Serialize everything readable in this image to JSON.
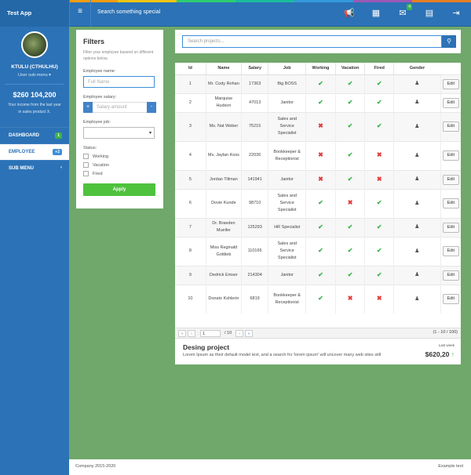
{
  "colors": {
    "primary": "#2c72b6",
    "success": "#3bb34a",
    "danger": "#e33d3d",
    "background": "#6fa86a",
    "stripe": [
      "#e74c3c",
      "#f39c12",
      "#f1c40f",
      "#2ecc71",
      "#1abc9c",
      "#3498db",
      "#9b59b6",
      "#e67e22"
    ]
  },
  "topbar": {
    "app_title": "Test App",
    "menu_icon": "≡",
    "search_placeholder": "Search something special",
    "icons": [
      {
        "name": "megaphone-icon",
        "glyph": "📢",
        "badge": ""
      },
      {
        "name": "grid-icon",
        "glyph": "▦",
        "badge": ""
      },
      {
        "name": "mail-icon",
        "glyph": "✉",
        "badge": "4"
      },
      {
        "name": "document-icon",
        "glyph": "▤",
        "badge": ""
      },
      {
        "name": "logout-icon",
        "glyph": "⇥",
        "badge": ""
      }
    ]
  },
  "sidebar": {
    "user_name": "KTULU (CTHULHU)",
    "user_sub": "User sub-menu ▾",
    "income": "$260 104,200",
    "income_desc": "Your income from the last year in sales product X.",
    "items": [
      {
        "label": "DASHBOARD",
        "badge": "1",
        "badge_type": "green",
        "active": false
      },
      {
        "label": "EMPLOYEE",
        "badge": "+2",
        "badge_type": "blue",
        "active": true
      },
      {
        "label": "SUB MENU",
        "badge": "",
        "badge_type": "",
        "active": false
      }
    ]
  },
  "filters": {
    "title": "Filters",
    "description": "Filter your employee basend on different options below.",
    "name_label": "Employee name:",
    "name_placeholder": "Full Name",
    "salary_label": "Employee salary:",
    "salary_placeholder": "Salary amount",
    "plus": "+",
    "minus": "-",
    "job_label": "Employee job:",
    "status_label": "Status:",
    "statuses": [
      "Working",
      "Vacation",
      "Fired"
    ],
    "apply_label": "Apply"
  },
  "search": {
    "placeholder": "Search projects..."
  },
  "table": {
    "headers": [
      "Id",
      "Name",
      "Salary",
      "Job",
      "Working",
      "Vacation",
      "Fired",
      "Gender"
    ],
    "edit_label": "Edit",
    "rows": [
      {
        "id": "1",
        "name": "Mr. Cody Rohan",
        "salary": "17363",
        "job": "Big BOSS",
        "working": true,
        "vacation": true,
        "fired": true
      },
      {
        "id": "2",
        "name": "Marquise Hudson",
        "salary": "47013",
        "job": "Janitor",
        "working": true,
        "vacation": true,
        "fired": true
      },
      {
        "id": "3",
        "name": "Ms. Nat Weber",
        "salary": "75215",
        "job": "Sales and Service Specialist",
        "working": false,
        "vacation": true,
        "fired": true
      },
      {
        "id": "4",
        "name": "Ms. Jaylan Koss",
        "salary": "22036",
        "job": "Bookkeeper & Receptionist",
        "working": false,
        "vacation": true,
        "fired": false
      },
      {
        "id": "5",
        "name": "Jordan Tillman",
        "salary": "141941",
        "job": "Janitor",
        "working": false,
        "vacation": true,
        "fired": false
      },
      {
        "id": "6",
        "name": "Dovie Kunde",
        "salary": "98710",
        "job": "Sales and Service Specialist",
        "working": true,
        "vacation": false,
        "fired": true
      },
      {
        "id": "7",
        "name": "Dr. Braeden Mueller",
        "salary": "125293",
        "job": "HR Specialist",
        "working": true,
        "vacation": true,
        "fired": true
      },
      {
        "id": "8",
        "name": "Miss Reginald Gottlieb",
        "salary": "110165",
        "job": "Sales and Service Specialist",
        "working": true,
        "vacation": true,
        "fired": true
      },
      {
        "id": "9",
        "name": "Dedrick Emser",
        "salary": "214304",
        "job": "Janitor",
        "working": true,
        "vacation": true,
        "fired": true
      },
      {
        "id": "10",
        "name": "Donato Kshlerin",
        "salary": "6819",
        "job": "Bookkeeper & Receptionist",
        "working": true,
        "vacation": false,
        "fired": false
      }
    ]
  },
  "pager": {
    "current_page": "1",
    "total_pages": "/ 10",
    "range": "(1 - 10 / 100)"
  },
  "project": {
    "title": "Desing project",
    "description": "Lorem Ipsum as their default model text, and a search for 'lorem ipsum' will uncover many web sites still",
    "period": "Last week",
    "amount": "$620,20",
    "trend_icon": "↑"
  },
  "footer": {
    "left": "Company 2015-2020",
    "right": "Example text"
  }
}
